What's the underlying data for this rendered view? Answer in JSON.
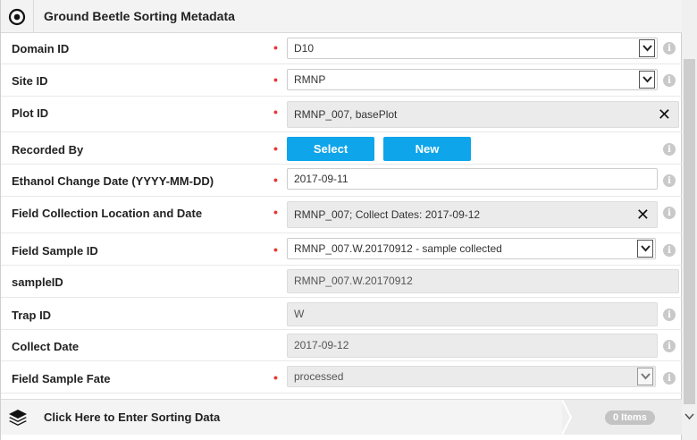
{
  "header": {
    "title": "Ground Beetle Sorting Metadata",
    "icon": "eye-icon"
  },
  "fields": {
    "domain_id": {
      "label": "Domain ID",
      "value": "D10"
    },
    "site_id": {
      "label": "Site ID",
      "value": "RMNP"
    },
    "plot_id": {
      "label": "Plot ID",
      "value": "RMNP_007, basePlot"
    },
    "recorded_by": {
      "label": "Recorded By",
      "select_label": "Select",
      "new_label": "New"
    },
    "ethanol_change_date": {
      "label": "Ethanol Change Date (YYYY-MM-DD)",
      "value": "2017-09-11"
    },
    "field_collection": {
      "label": "Field Collection Location and Date",
      "value": "RMNP_007; Collect Dates: 2017-09-12"
    },
    "field_sample_id": {
      "label": "Field Sample ID",
      "value": "RMNP_007.W.20170912 - sample collected"
    },
    "sample_id": {
      "label": "sampleID",
      "value": "RMNP_007.W.20170912"
    },
    "trap_id": {
      "label": "Trap ID",
      "value": "W"
    },
    "collect_date": {
      "label": "Collect Date",
      "value": "2017-09-12"
    },
    "field_sample_fate": {
      "label": "Field Sample Fate",
      "value": "processed"
    }
  },
  "required_marker": "•",
  "clear_symbol": "✕",
  "info_symbol": "i",
  "footer": {
    "text": "Click Here to Enter Sorting Data",
    "count": "0 Items"
  },
  "colors": {
    "accent": "#0ea5ea",
    "required": "#e53935"
  }
}
